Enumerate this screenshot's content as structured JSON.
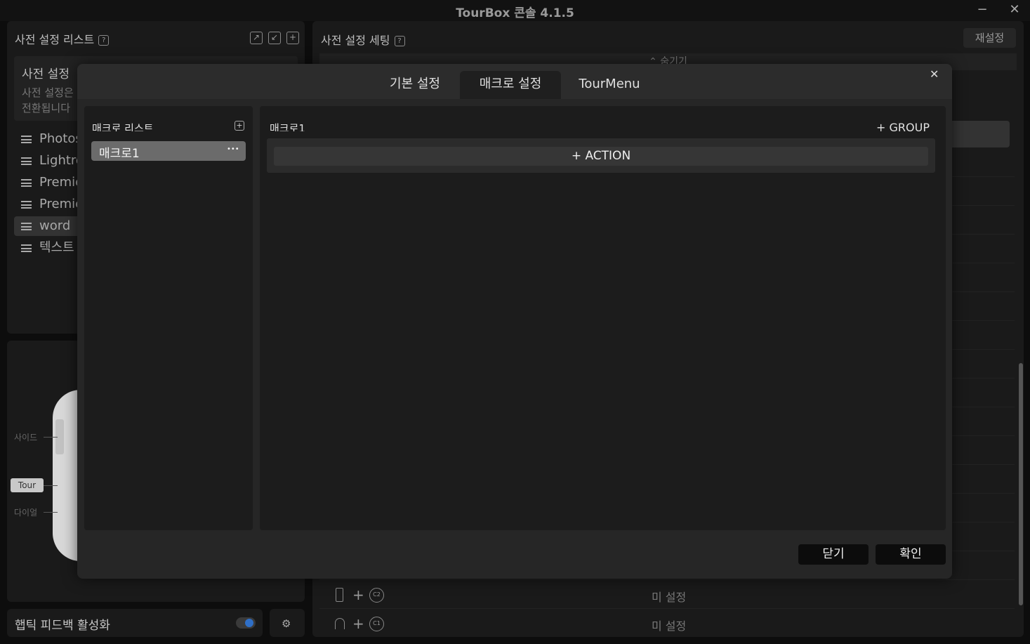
{
  "window": {
    "title": "TourBox 콘솔 4.1.5",
    "min": "−",
    "close": "✕"
  },
  "left_panel": {
    "title": "사전 설정 리스트",
    "help": "?",
    "card_title": "사전 설정",
    "card_desc_line1": "사전 설정은",
    "card_desc_line2": "전환됩니다",
    "items": [
      "Photos",
      "Lightro",
      "Premie",
      "Premie",
      "word",
      "텍스트"
    ]
  },
  "device": {
    "label_side": "사이드",
    "label_tour": "Tour",
    "label_dial": "다이얼"
  },
  "haptic": {
    "label": "햅틱 피드백 활성화"
  },
  "right_panel": {
    "title": "사전 설정 세팅",
    "help": "?",
    "reset": "재설정",
    "collapse": "⌃ 숨기기",
    "rows": [
      {
        "key": "C2",
        "value": "미 설정"
      },
      {
        "key": "C1",
        "value": "미 설정"
      }
    ]
  },
  "modal": {
    "tabs": [
      "기본 설정",
      "매크로 설정",
      "TourMenu"
    ],
    "active_tab": 1,
    "close": "✕",
    "macro_list_title": "매크로 리스트",
    "add_icon": "+",
    "macros": [
      "매크로1"
    ],
    "more": "•••",
    "editor_title": "매크로1",
    "add_group": "+  GROUP",
    "add_action": "+  ACTION",
    "cancel": "닫기",
    "ok": "확인"
  },
  "colors": {
    "accent": "#2f6fc7",
    "modal_bg": "#262626",
    "selected": "#6b6b6b"
  }
}
